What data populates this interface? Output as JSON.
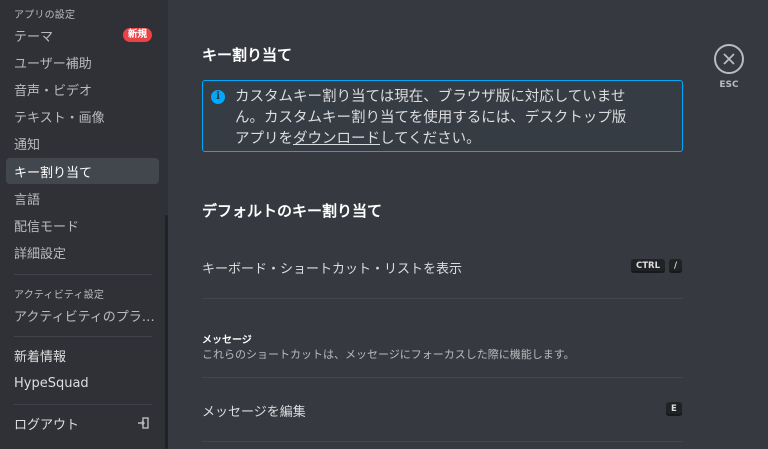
{
  "sidebar": {
    "app_settings_header": "アプリの設定",
    "items": [
      {
        "label": "テーマ",
        "badge": "新規"
      },
      {
        "label": "ユーザー補助"
      },
      {
        "label": "音声・ビデオ"
      },
      {
        "label": "テキスト・画像"
      },
      {
        "label": "通知"
      },
      {
        "label": "キー割り当て"
      },
      {
        "label": "言語"
      },
      {
        "label": "配信モード"
      },
      {
        "label": "詳細設定"
      }
    ],
    "activity_header": "アクティビティ設定",
    "activity_item": "アクティビティのプラ…",
    "whats_new": "新着情報",
    "hypesquad": "HypeSquad",
    "logout": "ログアウト"
  },
  "main": {
    "title": "キー割り当て",
    "notice": {
      "line1": "カスタムキー割り当ては現在、ブラウザ版に対応していませ",
      "line2": "ん。カスタムキー割り当てを使用するには、デスクトップ版",
      "line3_pre": "アプリを",
      "link": "ダウンロード",
      "line3_post": "してください。",
      "icon": "i"
    },
    "default_title": "デフォルトのキー割り当て",
    "shortcut_row": {
      "label": "キーボード・ショートカット・リストを表示",
      "keys": [
        "CTRL",
        "/"
      ]
    },
    "messages_header": "メッセージ",
    "messages_desc": "これらのショートカットは、メッセージにフォーカスした際に機能します。",
    "edit_row": {
      "label": "メッセージを編集",
      "keys": [
        "E"
      ]
    }
  },
  "close": {
    "esc_label": "ESC"
  },
  "colors": {
    "accent_blue": "#00a8fc",
    "badge_red": "#ed4245",
    "sidebar_bg": "#2f3136",
    "main_bg": "#36393f"
  }
}
